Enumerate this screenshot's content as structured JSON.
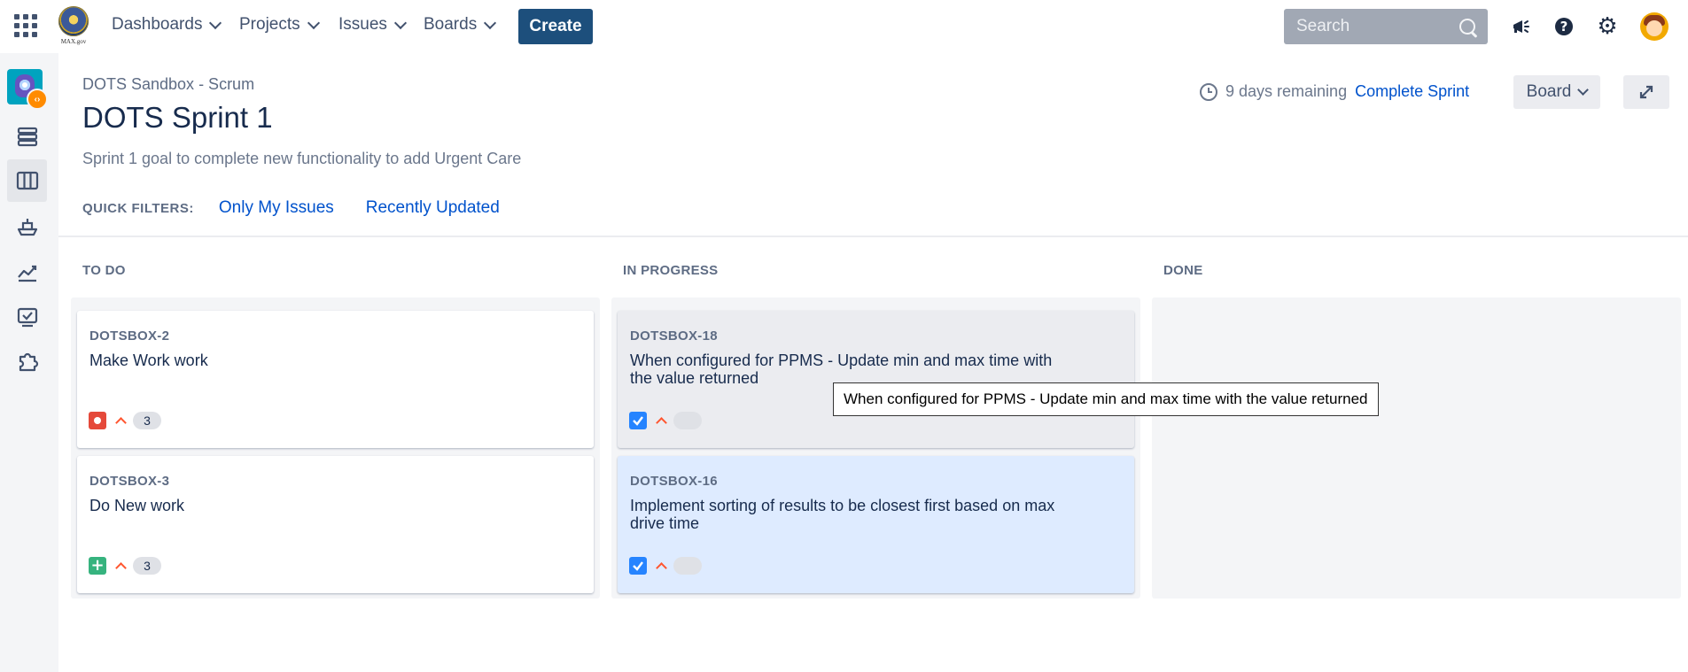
{
  "topnav": {
    "logo_text": "MAX.gov",
    "items": [
      {
        "label": "Dashboards"
      },
      {
        "label": "Projects"
      },
      {
        "label": "Issues"
      },
      {
        "label": "Boards"
      }
    ],
    "create_label": "Create",
    "search_placeholder": "Search",
    "icons": [
      "apps-grid-icon",
      "notifications-megaphone-icon",
      "help-icon",
      "gear-icon",
      "user-avatar"
    ],
    "colors": {
      "create_bg": "#1d4f7c",
      "search_bg": "#a1a8b4"
    }
  },
  "sidebar": {
    "items": [
      {
        "icon": "project-avatar"
      },
      {
        "icon": "backlog-icon"
      },
      {
        "icon": "board-icon",
        "active": true
      },
      {
        "icon": "releases-icon"
      },
      {
        "icon": "reports-icon"
      },
      {
        "icon": "issues-icon"
      },
      {
        "icon": "add-ons-icon"
      }
    ]
  },
  "header": {
    "breadcrumb": "DOTS Sandbox - Scrum",
    "title": "DOTS Sprint 1",
    "sprint_goal": "Sprint 1 goal to complete new functionality to add Urgent Care",
    "days_remaining": "9 days remaining",
    "complete_sprint": "Complete Sprint",
    "board_button": "Board"
  },
  "quick_filters": {
    "label": "QUICK FILTERS:",
    "filters": [
      "Only My Issues",
      "Recently Updated"
    ]
  },
  "board": {
    "columns": [
      {
        "title": "TO DO",
        "cards": [
          {
            "key": "DOTSBOX-2",
            "summary": "Make Work work",
            "type": "bug",
            "priority": "high",
            "estimate": "3"
          },
          {
            "key": "DOTSBOX-3",
            "summary": "Do New work",
            "type": "new-feature",
            "priority": "high",
            "estimate": "3"
          }
        ]
      },
      {
        "title": "IN PROGRESS",
        "cards": [
          {
            "key": "DOTSBOX-18",
            "summary": "When configured for PPMS - Update min and max time with the value returned",
            "type": "task",
            "priority": "high",
            "estimate": ""
          },
          {
            "key": "DOTSBOX-16",
            "summary": "Implement sorting of results to be closest first based on max drive time",
            "type": "task",
            "priority": "high",
            "estimate": "",
            "selected": true
          }
        ]
      },
      {
        "title": "DONE",
        "cards": []
      }
    ]
  },
  "tooltip": {
    "text": "When configured for PPMS - Update min and max time with the value returned"
  },
  "colors": {
    "link": "#0052cc",
    "selected_card": "#deebff",
    "bug": "#e5493a",
    "new_feature": "#36b37e",
    "task": "#2684ff",
    "priority_high": "#ff5630"
  }
}
